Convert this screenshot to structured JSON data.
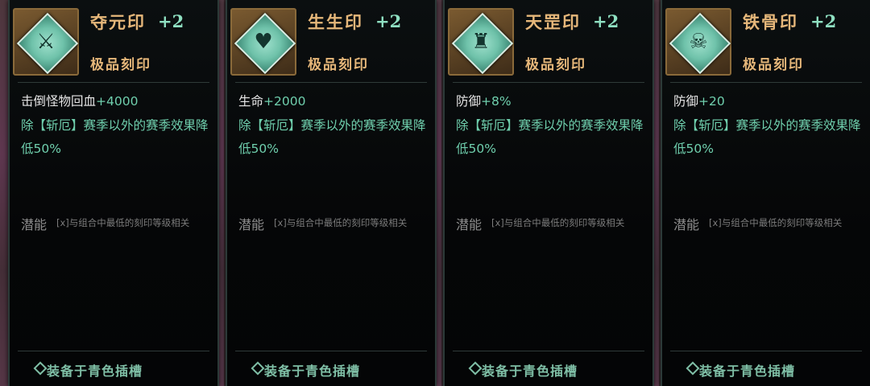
{
  "cards": [
    {
      "icon": "sword-emblem-icon",
      "glyph": "⚔",
      "name": "夺元印",
      "level": "+2",
      "rarity": "极品刻印",
      "stat_label": "击倒怪物回血",
      "stat_value": "+4000",
      "effect": "除【斩厄】赛季以外的赛季效果降低50%",
      "potential_label": "潜能",
      "potential_desc": "[x]与组合中最低的刻印等级相关",
      "footer": "装备于青色插槽"
    },
    {
      "icon": "heart-emblem-icon",
      "glyph": "♥",
      "name": "生生印",
      "level": "+2",
      "rarity": "极品刻印",
      "stat_label": "生命",
      "stat_value": "+2000",
      "effect": "除【斩厄】赛季以外的赛季效果降低50%",
      "potential_label": "潜能",
      "potential_desc": "[x]与组合中最低的刻印等级相关",
      "footer": "装备于青色插槽"
    },
    {
      "icon": "spire-emblem-icon",
      "glyph": "♜",
      "name": "天罡印",
      "level": "+2",
      "rarity": "极品刻印",
      "stat_label": "防御",
      "stat_value": "+8%",
      "effect": "除【斩厄】赛季以外的赛季效果降低50%",
      "potential_label": "潜能",
      "potential_desc": "[x]与组合中最低的刻印等级相关",
      "footer": "装备于青色插槽"
    },
    {
      "icon": "skull-emblem-icon",
      "glyph": "☠",
      "name": "铁骨印",
      "level": "+2",
      "rarity": "极品刻印",
      "stat_label": "防御",
      "stat_value": "+20",
      "effect": "除【斩厄】赛季以外的赛季效果降低50%",
      "potential_label": "潜能",
      "potential_desc": "[x]与组合中最低的刻印等级相关",
      "footer": "装备于青色插槽"
    }
  ]
}
